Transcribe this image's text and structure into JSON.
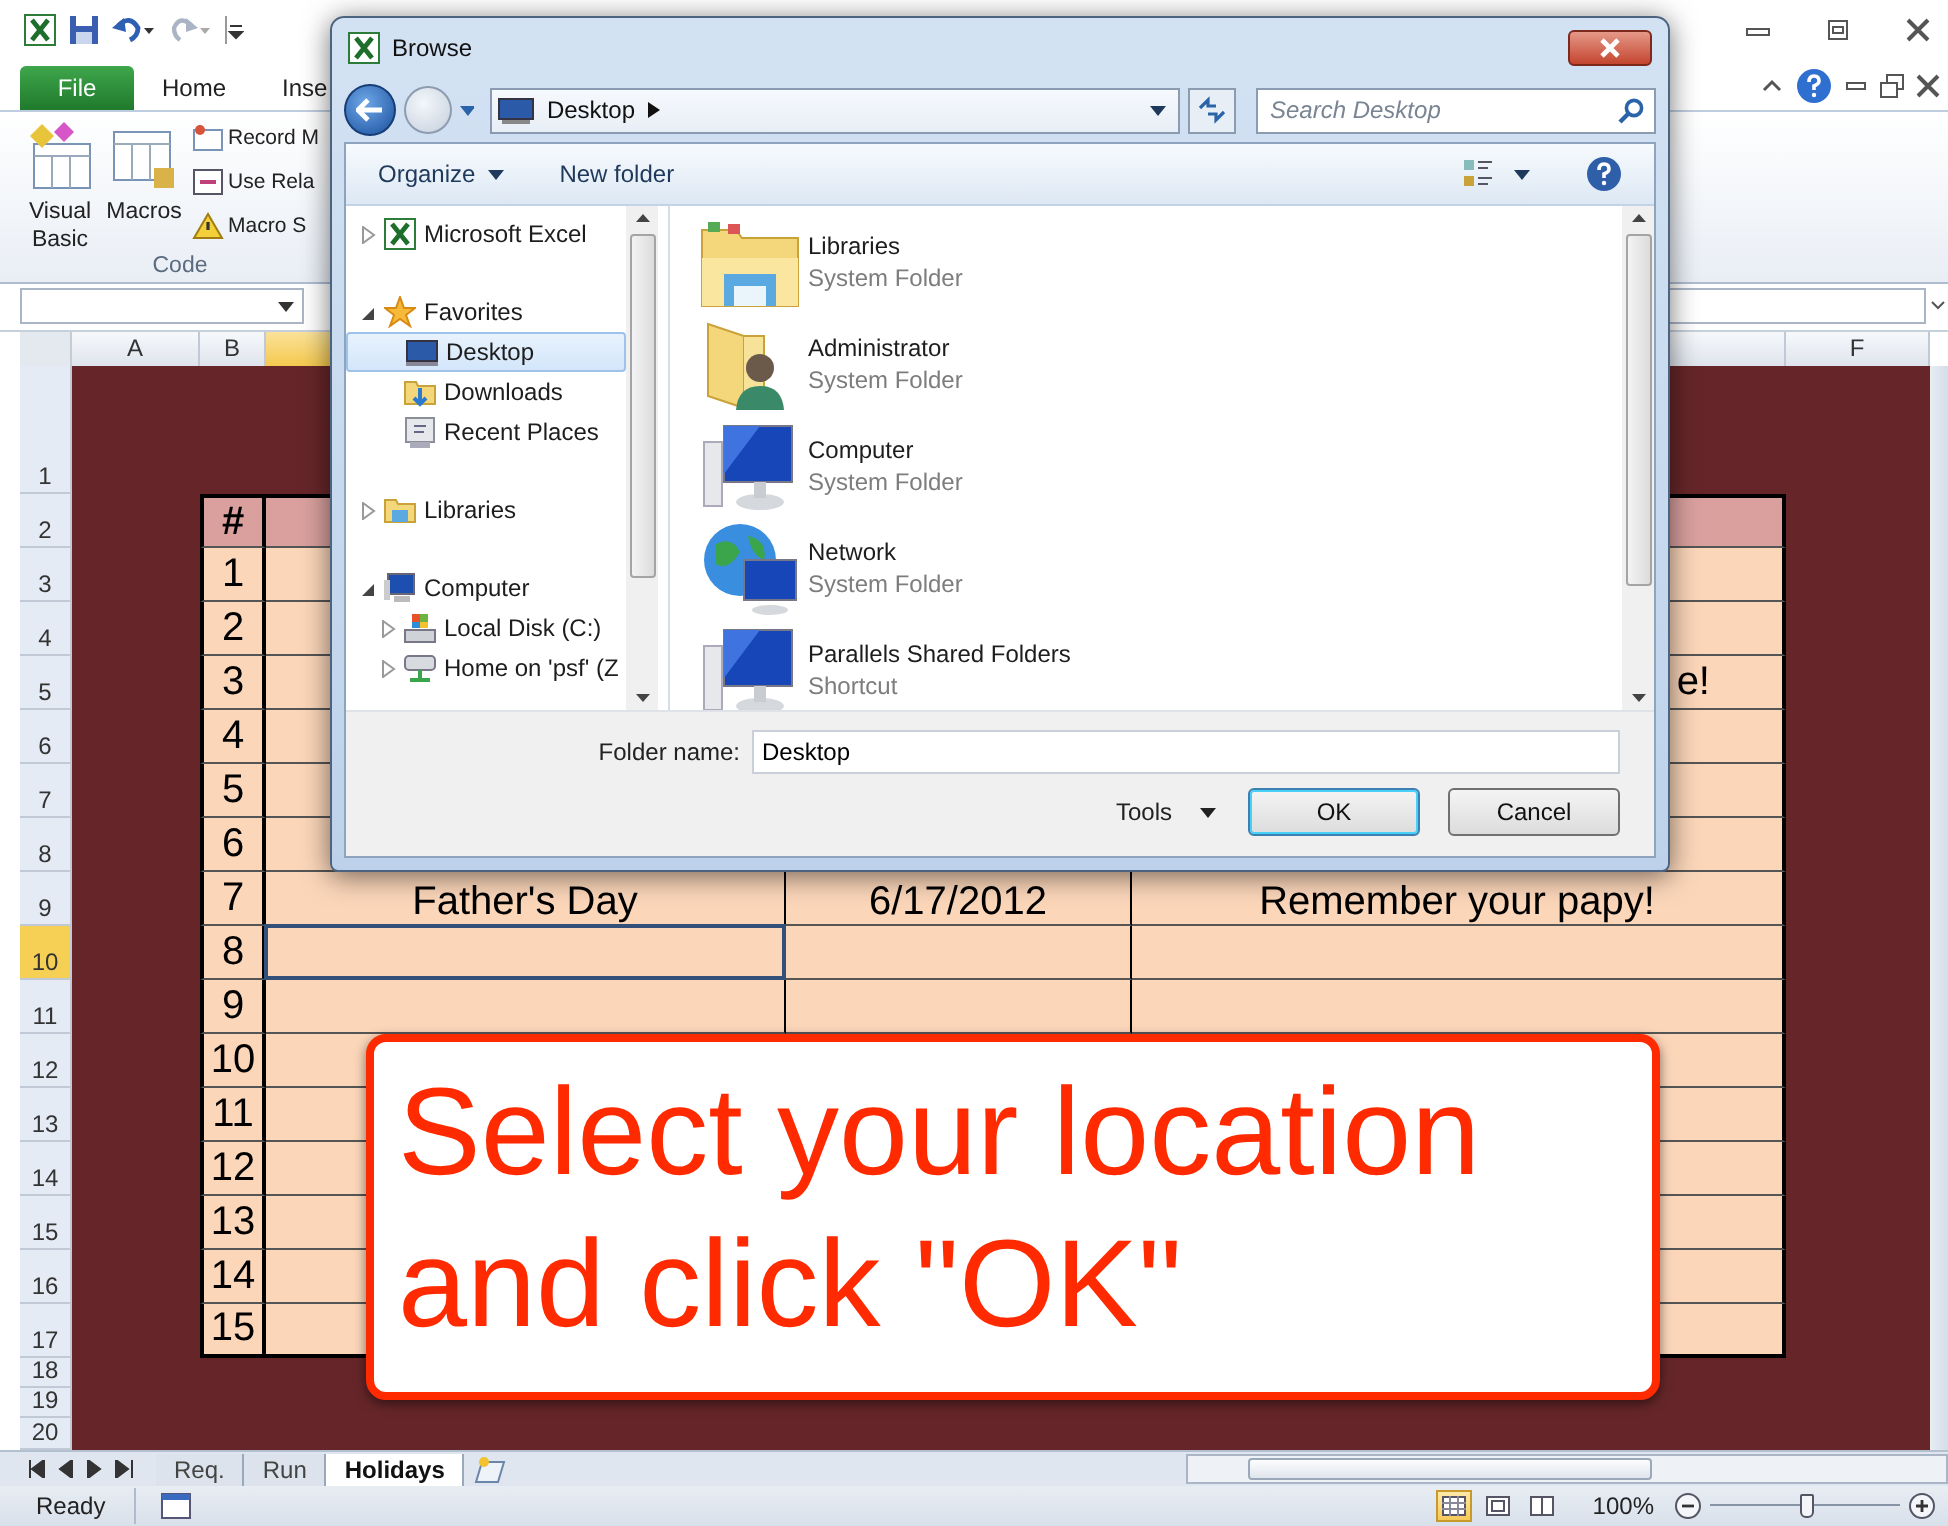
{
  "excel": {
    "ribbon_tabs": [
      {
        "label": "File",
        "kind": "file"
      },
      {
        "label": "Home",
        "kind": "tab"
      },
      {
        "label": "Inse",
        "kind": "tab"
      }
    ],
    "ribbon_buttons": [
      {
        "label": "Visual Basic",
        "kind": "vba"
      },
      {
        "label": "Macros",
        "kind": "macros"
      },
      {
        "label": "Record M",
        "kind": "record"
      },
      {
        "label": "Use Rela",
        "kind": "relative"
      },
      {
        "label": "Macro S",
        "kind": "security"
      }
    ],
    "ribbon_group_label": "Code",
    "columns": [
      {
        "label": "A",
        "selected": false
      },
      {
        "label": "B",
        "selected": false
      },
      {
        "selected": true
      },
      {
        "label": "F",
        "selected": false
      }
    ],
    "row_headers": [
      {
        "label": "1",
        "selected": false
      },
      {
        "label": "2",
        "selected": false
      },
      {
        "label": "3",
        "selected": false
      },
      {
        "label": "4",
        "selected": false
      },
      {
        "label": "5",
        "selected": false
      },
      {
        "label": "6",
        "selected": false
      },
      {
        "label": "7",
        "selected": false
      },
      {
        "label": "8",
        "selected": false
      },
      {
        "label": "9",
        "selected": false
      },
      {
        "label": "10",
        "selected": true
      },
      {
        "label": "11",
        "selected": false
      },
      {
        "label": "12",
        "selected": false
      },
      {
        "label": "13",
        "selected": false
      },
      {
        "label": "14",
        "selected": false
      },
      {
        "label": "15",
        "selected": false
      },
      {
        "label": "16",
        "selected": false
      },
      {
        "label": "17",
        "selected": false
      },
      {
        "label": "18",
        "selected": false
      },
      {
        "label": "19",
        "selected": false
      },
      {
        "label": "20",
        "selected": false
      }
    ],
    "table": {
      "header": "#",
      "rows": [
        {
          "number": "1",
          "selected": false
        },
        {
          "number": "2",
          "selected": false
        },
        {
          "number": "3",
          "selected": false,
          "column_e": "e!"
        },
        {
          "number": "4",
          "selected": false
        },
        {
          "number": "5",
          "selected": false
        },
        {
          "number": "6",
          "selected": false
        },
        {
          "number": "7",
          "selected": false,
          "column_c": "Father's Day",
          "column_d": "6/17/2012",
          "column_e": "Remember your papy!"
        },
        {
          "number": "8",
          "selected": true
        },
        {
          "number": "9",
          "selected": false
        },
        {
          "number": "10",
          "selected": false
        },
        {
          "number": "11",
          "selected": false
        },
        {
          "number": "12",
          "selected": false
        },
        {
          "number": "13",
          "selected": false
        },
        {
          "number": "14",
          "selected": false
        },
        {
          "number": "15",
          "selected": false
        }
      ]
    },
    "sheet_tabs": [
      {
        "label": "Req.",
        "selected": false
      },
      {
        "label": "Run",
        "selected": false
      },
      {
        "label": "Holidays",
        "selected": true
      }
    ],
    "status_bar": {
      "text": "Ready",
      "view_buttons": [
        {
          "kind": "normal",
          "selected": true
        },
        {
          "kind": "layout",
          "selected": false
        },
        {
          "kind": "pagebreak",
          "selected": false
        }
      ],
      "zoom": "100%",
      "zoom_slider": {
        "level": 0.5
      }
    }
  },
  "dialog": {
    "title": "Browse",
    "address": "Desktop",
    "search_placeholder": "Search Desktop",
    "toolbar": [
      {
        "label": "Organize",
        "kind": "menu"
      },
      {
        "label": "New folder",
        "kind": "button"
      }
    ],
    "nav_tree": [
      {
        "label": "Microsoft Excel",
        "kind": "excel",
        "expanded": false,
        "selected": false
      },
      {
        "label": "Favorites",
        "kind": "star",
        "expanded": true,
        "selected": false,
        "children": [
          {
            "label": "Desktop",
            "kind": "desktop",
            "selected": true
          },
          {
            "label": "Downloads",
            "kind": "downloads",
            "selected": false
          },
          {
            "label": "Recent Places",
            "kind": "recent",
            "selected": false
          }
        ]
      },
      {
        "label": "Libraries",
        "kind": "libraries",
        "expanded": false,
        "selected": false
      },
      {
        "label": "Computer",
        "kind": "computer",
        "expanded": true,
        "selected": false,
        "children": [
          {
            "label": "Local Disk (C:)",
            "kind": "disk",
            "expanded": false,
            "selected": false
          },
          {
            "label": "Home on 'psf' (Z",
            "kind": "netdrive",
            "expanded": false,
            "selected": false
          }
        ]
      }
    ],
    "items": [
      {
        "name": "Libraries",
        "type": "System Folder",
        "kind": "libraries"
      },
      {
        "name": "Administrator",
        "type": "System Folder",
        "kind": "user"
      },
      {
        "name": "Computer",
        "type": "System Folder",
        "kind": "computer"
      },
      {
        "name": "Network",
        "type": "System Folder",
        "kind": "network"
      },
      {
        "name": "Parallels Shared Folders",
        "type": "Shortcut",
        "kind": "computer"
      }
    ],
    "folder_name_label": "Folder name:",
    "folder_name": "Desktop",
    "buttons": [
      {
        "label": "Tools",
        "kind": "menu"
      },
      {
        "label": "OK",
        "kind": "default"
      },
      {
        "label": "Cancel",
        "kind": "normal"
      }
    ]
  },
  "callout": {
    "text": "Select your location and click \"OK\""
  }
}
